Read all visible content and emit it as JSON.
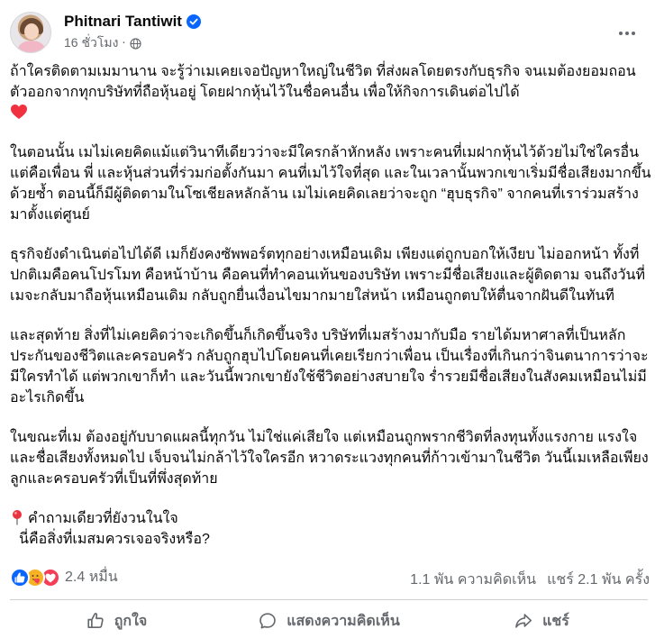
{
  "author": {
    "name": "Phitnari Tantiwit",
    "time": "16 ชั่วโมง",
    "separator": "·"
  },
  "icons": {
    "verified": "verified-badge-icon",
    "audience": "globe-icon",
    "more": "more-options-icon",
    "heart_emoji": "red-heart-emoji",
    "pin_emoji": "round-pushpin-emoji",
    "like_reaction": "like-reaction-icon",
    "care_reaction": "care-reaction-icon",
    "love_reaction": "love-reaction-icon",
    "like_action": "thumbs-up-icon",
    "comment_action": "comment-bubble-icon",
    "share_action": "share-arrow-icon"
  },
  "colors": {
    "verified": "#0866ff",
    "like": "#0866ff",
    "love": "#f33e58",
    "care": "#f7b125",
    "secondary_text": "#65686c"
  },
  "post": {
    "paragraphs": [
      "ถ้าใครติดตามเมมานาน จะรู้ว่าเมเคยเจอปัญหาใหญ่ในชีวิต ที่ส่งผลโดยตรงกับธุรกิจ จนเมต้องยอมถอนตัวออกจากทุกบริษัทที่ถือหุ้นอยู่ โดยฝากหุ้นไว้ในชื่อคนอื่น เพื่อให้กิจการเดินต่อไปได้",
      "ในตอนนั้น เมไม่เคยคิดแม้แต่วินาทีเดียวว่าจะมีใครกล้าหักหลัง เพราะคนที่เมฝากหุ้นไว้ด้วยไม่ใช่ใครอื่น แต่คือเพื่อน พี่ และหุ้นส่วนที่ร่วมก่อตั้งกันมา คนที่เมไว้ใจที่สุด และในเวลานั้นพวกเขาเริ่มมีชื่อเสียงมากขึ้นด้วยซ้ำ ตอนนี้ก็มีผู้ติดตามในโซเชียลหลักล้าน เมไม่เคยคิดเลยว่าจะถูก “ฮุบธุรกิจ” จากคนที่เราร่วมสร้างมาตั้งแต่ศูนย์",
      "ธุรกิจยังดำเนินต่อไปได้ดี เมก็ยังคงซัพพอร์ตทุกอย่างเหมือนเดิม เพียงแต่ถูกบอกให้เงียบ ไม่ออกหน้า ทั้งที่ปกติเมคือคนโปรโมท คือหน้าบ้าน คือคนที่ทำคอนเท้นของบริษัท เพราะมีชื่อเสียงและผู้ติดตาม จนถึงวันที่เมจะกลับมาถือหุ้นเหมือนเดิม กลับถูกยื่นเงื่อนไขมากมายใส่หน้า เหมือนถูกตบให้ตื่นจากฝันดีในทันที",
      "และสุดท้าย สิ่งที่ไม่เคยคิดว่าจะเกิดขึ้นก็เกิดขึ้นจริง บริษัทที่เมสร้างมากับมือ รายได้มหาศาลที่เป็นหลักประกันของชีวิตและครอบครัว กลับถูกฮุบไปโดยคนที่เคยเรียกว่าเพื่อน เป็นเรื่องที่เกินกว่าจินตนาการว่าจะมีใครทำได้ แต่พวกเขาก็ทำ และวันนี้พวกเขายังใช้ชีวิตอย่างสบายใจ ร่ำรวยมีชื่อเสียงในสังคมเหมือนไม่มีอะไรเกิดขึ้น",
      "ในขณะที่เม ต้องอยู่กับบาดแผลนี้ทุกวัน ไม่ใช่แค่เสียใจ แต่เหมือนถูกพรากชีวิตที่ลงทุนทั้งแรงกาย แรงใจ และชื่อเสียงทั้งหมดไป เจ็บจนไม่กล้าไว้ใจใครอีก หวาดระแวงทุกคนที่ก้าวเข้ามาในชีวิต วันนี้เมเหลือเพียงลูกและครอบครัวที่เป็นที่พึ่งสุดท้าย"
    ],
    "question_line_1": "คำถามเดียวที่ยังวนในใจ",
    "question_line_2": "นี่คือสิ่งที่เมสมควรเจอจริงหรือ?"
  },
  "stats": {
    "reactions_count": "2.4 หมื่น",
    "comments": "1.1 พัน ความคิดเห็น",
    "shares": "แชร์ 2.1 พัน ครั้ง"
  },
  "actions": {
    "like_label": "ถูกใจ",
    "comment_label": "แสดงความคิดเห็น",
    "share_label": "แชร์"
  }
}
